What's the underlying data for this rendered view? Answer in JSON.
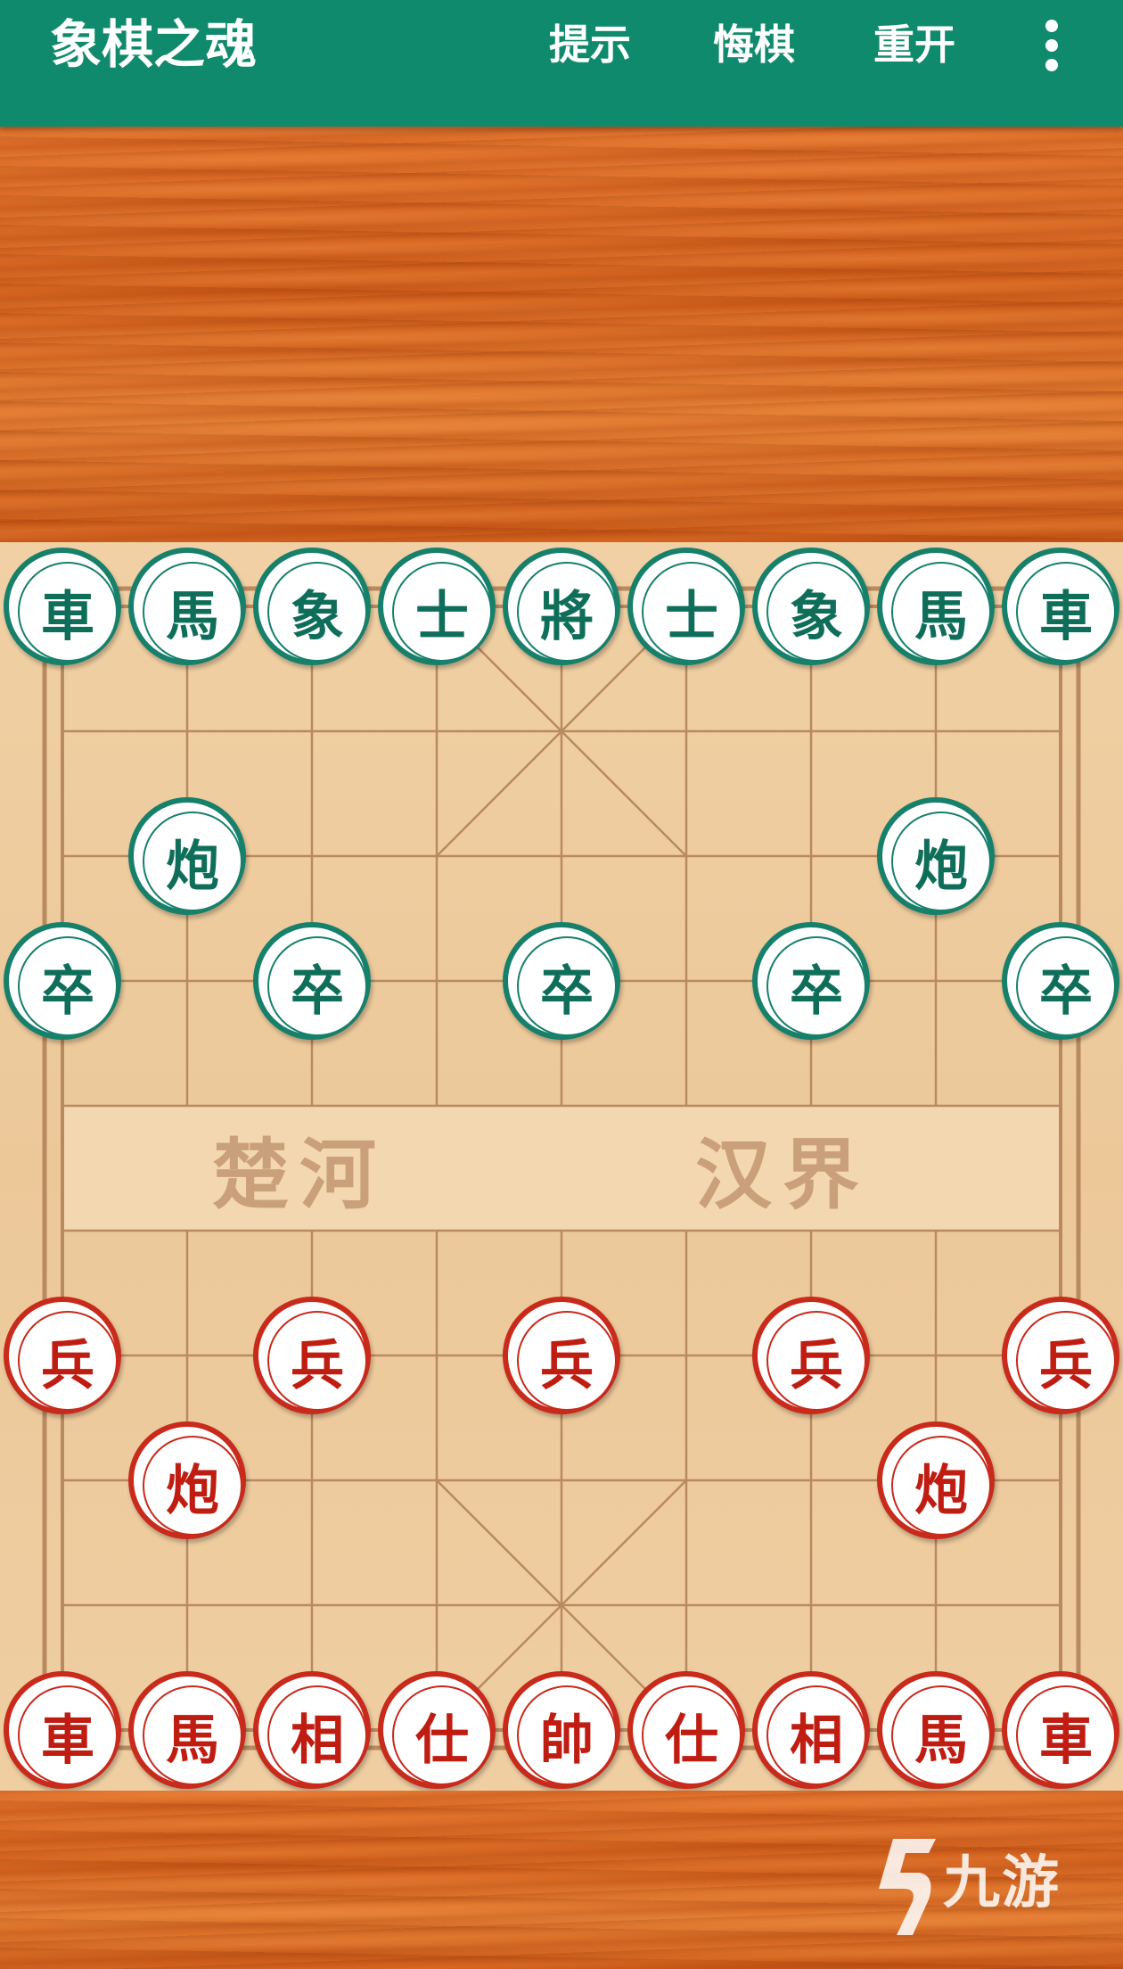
{
  "app": {
    "title": "象棋之魂",
    "menu": {
      "hint": "提示",
      "undo": "悔棋",
      "restart": "重开"
    }
  },
  "board": {
    "river_left": "楚河",
    "river_right": "汉界",
    "files": 9,
    "ranks": 10,
    "pieces": [
      {
        "side": "black",
        "label": "車",
        "file": 0,
        "rank": 0
      },
      {
        "side": "black",
        "label": "馬",
        "file": 1,
        "rank": 0
      },
      {
        "side": "black",
        "label": "象",
        "file": 2,
        "rank": 0
      },
      {
        "side": "black",
        "label": "士",
        "file": 3,
        "rank": 0
      },
      {
        "side": "black",
        "label": "將",
        "file": 4,
        "rank": 0
      },
      {
        "side": "black",
        "label": "士",
        "file": 5,
        "rank": 0
      },
      {
        "side": "black",
        "label": "象",
        "file": 6,
        "rank": 0
      },
      {
        "side": "black",
        "label": "馬",
        "file": 7,
        "rank": 0
      },
      {
        "side": "black",
        "label": "車",
        "file": 8,
        "rank": 0
      },
      {
        "side": "black",
        "label": "炮",
        "file": 1,
        "rank": 2
      },
      {
        "side": "black",
        "label": "炮",
        "file": 7,
        "rank": 2
      },
      {
        "side": "black",
        "label": "卒",
        "file": 0,
        "rank": 3
      },
      {
        "side": "black",
        "label": "卒",
        "file": 2,
        "rank": 3
      },
      {
        "side": "black",
        "label": "卒",
        "file": 4,
        "rank": 3
      },
      {
        "side": "black",
        "label": "卒",
        "file": 6,
        "rank": 3
      },
      {
        "side": "black",
        "label": "卒",
        "file": 8,
        "rank": 3
      },
      {
        "side": "red",
        "label": "兵",
        "file": 0,
        "rank": 6
      },
      {
        "side": "red",
        "label": "兵",
        "file": 2,
        "rank": 6
      },
      {
        "side": "red",
        "label": "兵",
        "file": 4,
        "rank": 6
      },
      {
        "side": "red",
        "label": "兵",
        "file": 6,
        "rank": 6
      },
      {
        "side": "red",
        "label": "兵",
        "file": 8,
        "rank": 6
      },
      {
        "side": "red",
        "label": "炮",
        "file": 1,
        "rank": 7
      },
      {
        "side": "red",
        "label": "炮",
        "file": 7,
        "rank": 7
      },
      {
        "side": "red",
        "label": "車",
        "file": 0,
        "rank": 9
      },
      {
        "side": "red",
        "label": "馬",
        "file": 1,
        "rank": 9
      },
      {
        "side": "red",
        "label": "相",
        "file": 2,
        "rank": 9
      },
      {
        "side": "red",
        "label": "仕",
        "file": 3,
        "rank": 9
      },
      {
        "side": "red",
        "label": "帥",
        "file": 4,
        "rank": 9
      },
      {
        "side": "red",
        "label": "仕",
        "file": 5,
        "rank": 9
      },
      {
        "side": "red",
        "label": "相",
        "file": 6,
        "rank": 9
      },
      {
        "side": "red",
        "label": "馬",
        "file": 7,
        "rank": 9
      },
      {
        "side": "red",
        "label": "車",
        "file": 8,
        "rank": 9
      }
    ]
  },
  "watermark": {
    "text": "九游",
    "logo": "jiuyou-logo-icon"
  },
  "colors": {
    "appbar": "#108a6c",
    "black_piece": "#17806b",
    "red_piece": "#c82a1c",
    "board": "#ecc899",
    "grid_line": "#b98a60"
  }
}
